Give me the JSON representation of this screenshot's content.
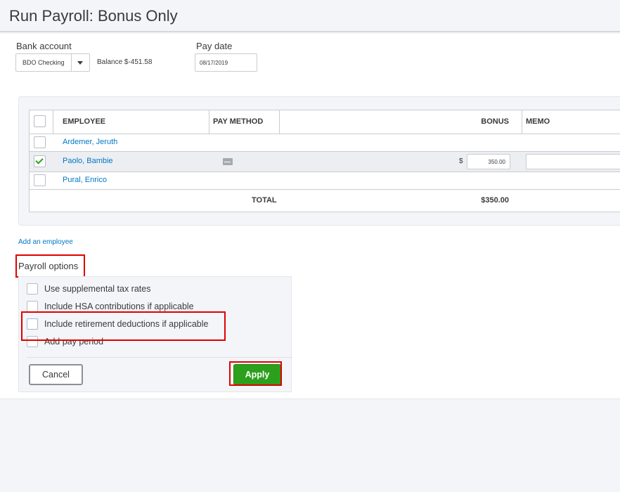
{
  "page": {
    "title": "Run Payroll: Bonus Only"
  },
  "top": {
    "bank_account_label": "Bank account",
    "bank_account_value": "BDO Checking",
    "balance": "Balance $-451.58",
    "pay_date_label": "Pay date",
    "pay_date_value": "08/17/2019"
  },
  "table": {
    "headers": {
      "employee": "EMPLOYEE",
      "pay_method": "PAY METHOD",
      "bonus": "BONUS",
      "memo": "MEMO"
    },
    "rows": [
      {
        "name": "Ardemer, Jeruth",
        "checked": false,
        "bonus": "",
        "pay_method_icon": ""
      },
      {
        "name": "Paolo, Bambie",
        "checked": true,
        "currency": "$",
        "bonus": "350.00",
        "pay_method_icon": "check-icon"
      },
      {
        "name": "Pural, Enrico",
        "checked": false,
        "bonus": "",
        "pay_method_icon": ""
      }
    ],
    "total_label": "TOTAL",
    "total_value": "$350.00"
  },
  "add_employee_link": "Add an employee",
  "payroll_options": {
    "label": "Payroll options",
    "items": [
      {
        "label": "Use supplemental tax rates",
        "checked": false
      },
      {
        "label": "Include HSA contributions if applicable",
        "checked": false
      },
      {
        "label": "Include retirement deductions if applicable",
        "checked": false
      },
      {
        "label": "Add pay period",
        "checked": false
      }
    ],
    "cancel_label": "Cancel",
    "apply_label": "Apply"
  },
  "colors": {
    "accent_green": "#2ca01c",
    "link_blue": "#0077c5",
    "highlight_red": "#e00000"
  }
}
